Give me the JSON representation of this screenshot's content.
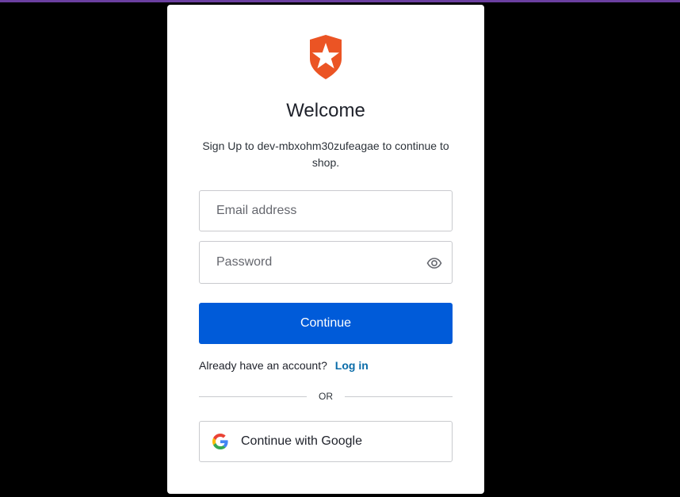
{
  "colors": {
    "accent": "#6b3fa0",
    "primary_button": "#005bd9",
    "link": "#0a6ca9",
    "logo": "#eb5424"
  },
  "logo": {
    "icon": "auth0-shield-star-icon"
  },
  "header": {
    "title": "Welcome",
    "subtitle": "Sign Up to dev-mbxohm30zufeagae to continue to shop."
  },
  "form": {
    "email": {
      "placeholder": "Email address",
      "value": ""
    },
    "password": {
      "placeholder": "Password",
      "value": "",
      "toggle_icon": "eye-icon"
    },
    "continue_label": "Continue"
  },
  "signin": {
    "prompt": "Already have an account?",
    "link_label": "Log in"
  },
  "divider": {
    "label": "OR"
  },
  "social": {
    "google_label": "Continue with Google",
    "google_icon": "google-icon"
  }
}
